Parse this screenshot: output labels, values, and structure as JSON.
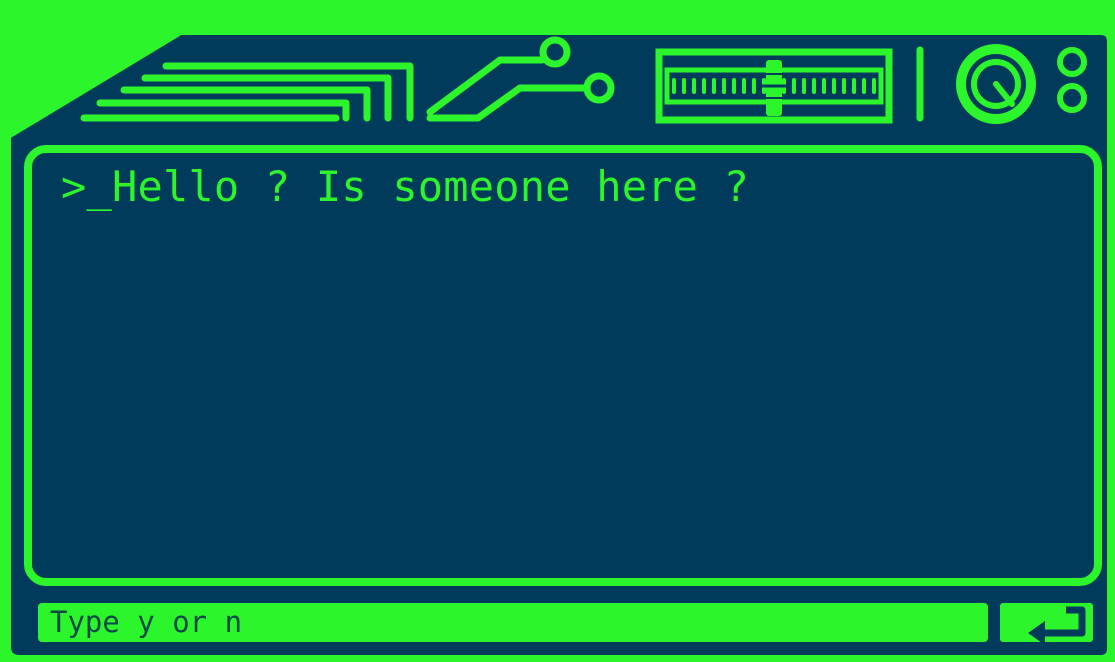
{
  "console": {
    "line": ">_Hello ? Is someone here ?"
  },
  "input": {
    "placeholder": "Type y or n",
    "value": ""
  },
  "icons": {
    "enter": "enter-icon",
    "dial": "dial-icon",
    "slider": "slider-icon",
    "circuit": "circuit-icon"
  },
  "colors": {
    "accent": "#2cf52c",
    "panel": "#003b5b"
  }
}
